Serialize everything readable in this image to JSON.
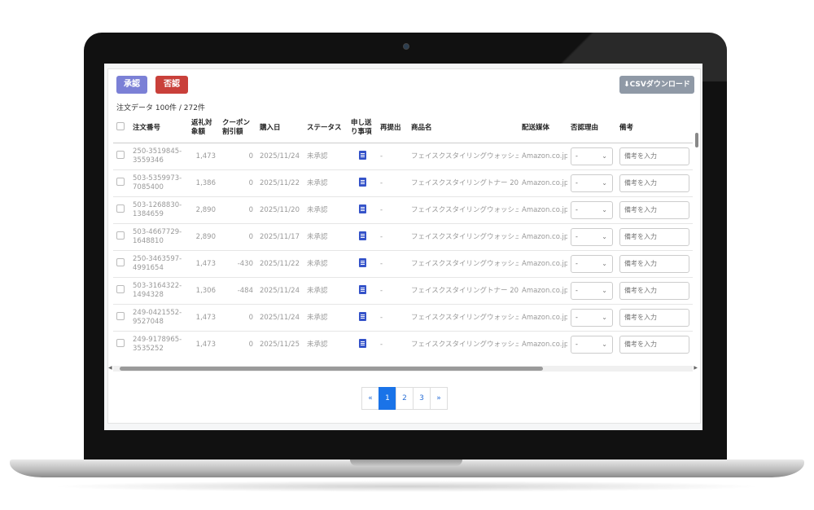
{
  "toolbar": {
    "approve_label": "承認",
    "reject_label": "否認",
    "csv_label": "⬇CSVダウンロード"
  },
  "summary": "注文データ 100件 / 272件",
  "table": {
    "headers": [
      "注文番号",
      "返礼対象額",
      "クーポン割引額",
      "購入日",
      "ステータス",
      "申し送り事項",
      "再提出",
      "商品名",
      "配送媒体",
      "否認理由",
      "備考"
    ],
    "rows": [
      {
        "order": "250-3519845-3559346",
        "amount": "1,473",
        "discount": "0",
        "date": "2025/11/24",
        "status": "未承認",
        "resubmit": "-",
        "product": "フェイスクスタイリングウォッシュ…",
        "media": "Amazon.co.jp",
        "reason": "-",
        "note_placeholder": "備考を入力"
      },
      {
        "order": "503-5359973-7085400",
        "amount": "1,386",
        "discount": "0",
        "date": "2025/11/22",
        "status": "未承認",
        "resubmit": "-",
        "product": "フェイスクスタイリングトナー 200…",
        "media": "Amazon.co.jp",
        "reason": "-",
        "note_placeholder": "備考を入力"
      },
      {
        "order": "503-1268830-1384659",
        "amount": "2,890",
        "discount": "0",
        "date": "2025/11/20",
        "status": "未承認",
        "resubmit": "-",
        "product": "フェイスクスタイリングウォッシュ…",
        "media": "Amazon.co.jp",
        "reason": "-",
        "note_placeholder": "備考を入力"
      },
      {
        "order": "503-4667729-1648810",
        "amount": "2,890",
        "discount": "0",
        "date": "2025/11/17",
        "status": "未承認",
        "resubmit": "-",
        "product": "フェイスクスタイリングウォッシュ…",
        "media": "Amazon.co.jp",
        "reason": "-",
        "note_placeholder": "備考を入力"
      },
      {
        "order": "250-3463597-4991654",
        "amount": "1,473",
        "discount": "-430",
        "date": "2025/11/22",
        "status": "未承認",
        "resubmit": "-",
        "product": "フェイスクスタイリングウォッシュ…",
        "media": "Amazon.co.jp",
        "reason": "-",
        "note_placeholder": "備考を入力"
      },
      {
        "order": "503-3164322-1494328",
        "amount": "1,306",
        "discount": "-484",
        "date": "2025/11/24",
        "status": "未承認",
        "resubmit": "-",
        "product": "フェイスクスタイリングトナー 200…",
        "media": "Amazon.co.jp",
        "reason": "-",
        "note_placeholder": "備考を入力"
      },
      {
        "order": "249-0421552-9527048",
        "amount": "1,473",
        "discount": "0",
        "date": "2025/11/24",
        "status": "未承認",
        "resubmit": "-",
        "product": "フェイスクスタイリングウォッシュ…",
        "media": "Amazon.co.jp",
        "reason": "-",
        "note_placeholder": "備考を入力"
      },
      {
        "order": "249-9178965-3535252",
        "amount": "1,473",
        "discount": "0",
        "date": "2025/11/25",
        "status": "未承認",
        "resubmit": "-",
        "product": "フェイスクスタイリングウォッシュ…",
        "media": "Amazon.co.jp",
        "reason": "-",
        "note_placeholder": "備考を入力"
      }
    ]
  },
  "pagination": {
    "prev": "«",
    "pages": [
      "1",
      "2",
      "3"
    ],
    "next": "»",
    "current": "1"
  },
  "icons": {
    "memo": "document-icon",
    "select": "chevron-down-icon"
  },
  "colors": {
    "approve": "#7b80d6",
    "reject": "#c9403a",
    "csv": "#8f99a6",
    "page_active": "#1a73e8",
    "memo_icon": "#3553c9"
  }
}
